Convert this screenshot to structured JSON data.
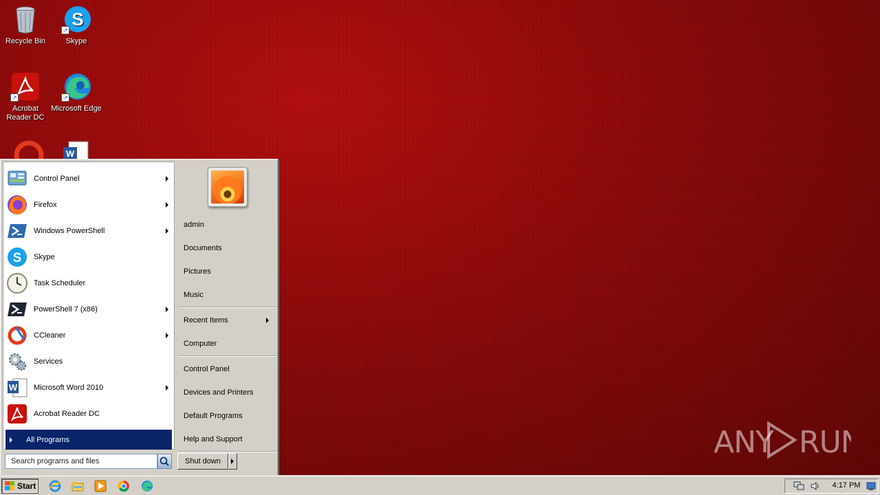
{
  "desktop": {
    "icons": [
      {
        "label": "Recycle Bin",
        "icon": "recycle-bin-icon"
      },
      {
        "label": "Skype",
        "icon": "skype-icon"
      },
      {
        "label": "Acrobat Reader DC",
        "icon": "acrobat-icon"
      },
      {
        "label": "Microsoft Edge",
        "icon": "edge-icon"
      }
    ]
  },
  "start_menu": {
    "programs": [
      {
        "label": "Control Panel",
        "icon": "control-panel-icon",
        "submenu": true
      },
      {
        "label": "Firefox",
        "icon": "firefox-icon",
        "submenu": true
      },
      {
        "label": "Windows PowerShell",
        "icon": "powershell-icon",
        "submenu": true
      },
      {
        "label": "Skype",
        "icon": "skype-icon",
        "submenu": false
      },
      {
        "label": "Task Scheduler",
        "icon": "task-scheduler-icon",
        "submenu": false
      },
      {
        "label": "PowerShell 7 (x86)",
        "icon": "powershell7-icon",
        "submenu": true
      },
      {
        "label": "CCleaner",
        "icon": "ccleaner-icon",
        "submenu": true
      },
      {
        "label": "Services",
        "icon": "services-icon",
        "submenu": false
      },
      {
        "label": "Microsoft Word 2010",
        "icon": "word-icon",
        "submenu": true
      },
      {
        "label": "Acrobat Reader DC",
        "icon": "acrobat-icon",
        "submenu": false
      }
    ],
    "all_programs": "All Programs",
    "search_placeholder": "Search programs and files",
    "right": {
      "user": "admin",
      "documents": "Documents",
      "pictures": "Pictures",
      "music": "Music",
      "recent_items": "Recent Items",
      "computer": "Computer",
      "control_panel": "Control Panel",
      "devices_printers": "Devices and Printers",
      "default_programs": "Default Programs",
      "help_support": "Help and Support"
    },
    "shutdown": "Shut down"
  },
  "taskbar": {
    "start_label": "Start",
    "quick_launch": [
      "ie-icon",
      "explorer-icon",
      "media-player-icon",
      "chrome-icon",
      "edge-icon"
    ],
    "clock": "4:17 PM"
  },
  "watermark": "ANY RUN"
}
